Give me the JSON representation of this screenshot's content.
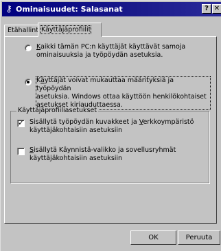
{
  "window": {
    "title": "Ominaisuudet: Salasanat",
    "help_label": "?",
    "close_label": "✕",
    "title_icon": "key-icon"
  },
  "tabs": [
    {
      "label": "Etähallinta",
      "active": false
    },
    {
      "label": "Käyttäjäprofiilit",
      "active": true
    }
  ],
  "options": {
    "option1": {
      "line1_pre": "",
      "line1_acc": "K",
      "line1_post": "aikki tämän PC:n käyttäjät käyttävät samoja",
      "line2": "ominaisuuksia ja työpöydän asetuksia.",
      "selected": false
    },
    "option2": {
      "line1_pre": "K",
      "line1_acc": "ä",
      "line1_post": "yttäjät voivat mukauttaa määrityksiä ja työpöydän",
      "line2": "asetuksia. Windows ottaa käyttöön henkilökohtaiset",
      "line3": "asetukset kirjauduttaessa.",
      "selected": true
    }
  },
  "group": {
    "label": "Käyttäjäprofiiliasetukset",
    "check1": {
      "line1_pre": "Sisällytä työpöydän kuvakkeet ja ",
      "line1_acc": "V",
      "line1_post": "erkkoympäristö",
      "line2": "käyttäjäkohtaisiin asetuksiin",
      "checked": true
    },
    "check2": {
      "line1_acc": "S",
      "line1_post": "isällytä Käynnistä-valikko ja sovellusryhmät",
      "line2": "käyttäjäkohtaisiin asetuksiin",
      "checked": false
    }
  },
  "buttons": {
    "ok": "OK",
    "cancel": "Peruuta"
  }
}
